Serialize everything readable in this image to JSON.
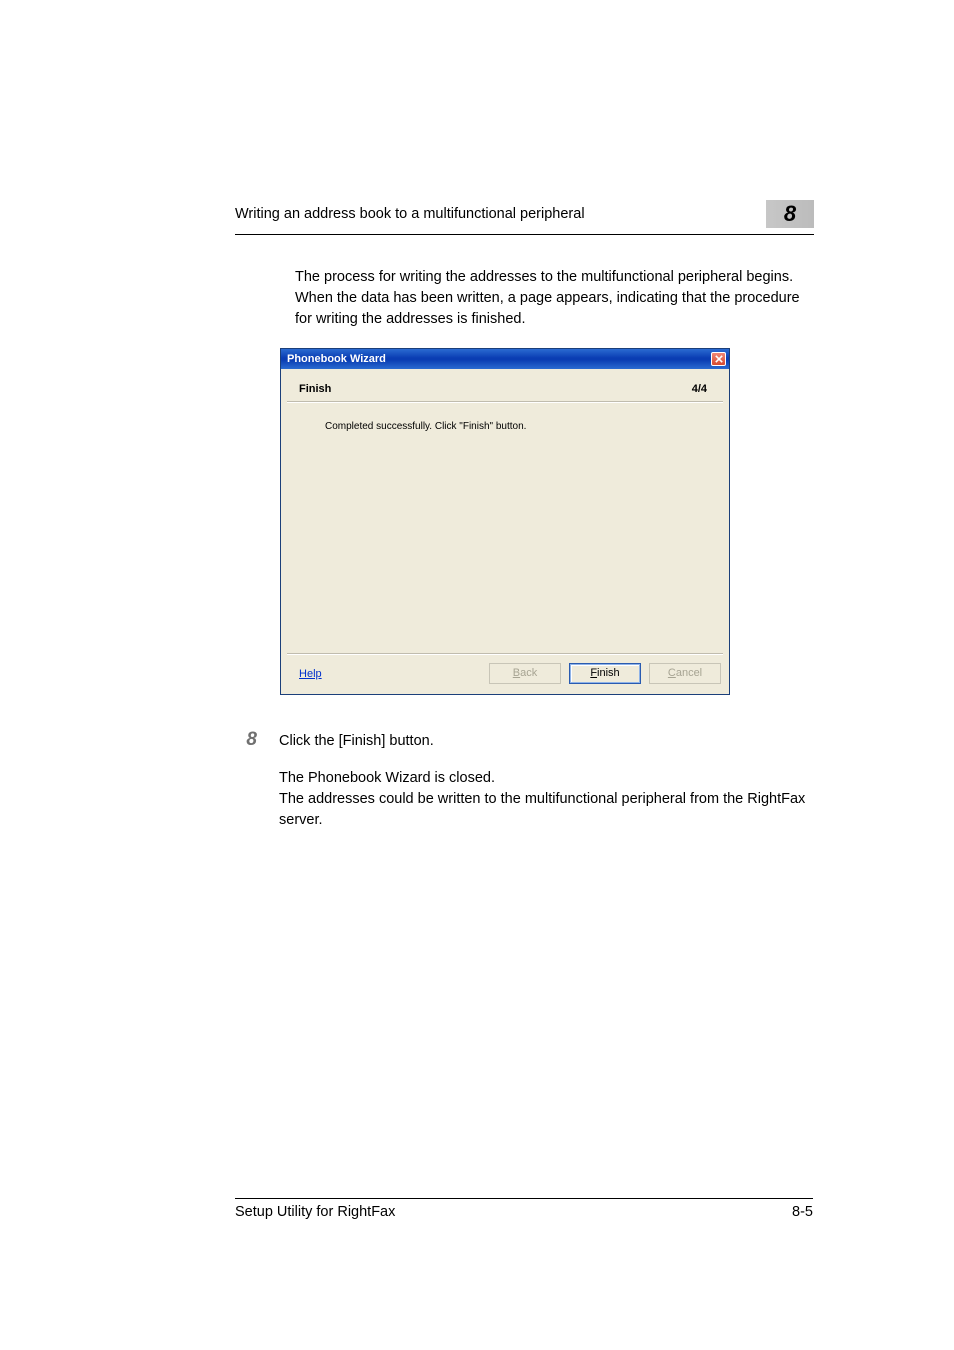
{
  "header": {
    "title": "Writing an address book to a multifunctional peripheral",
    "chapter_number": "8"
  },
  "intro_paragraph": "The process for writing the addresses to the multifunctional peripheral begins. When the data has been written, a page appears, indicating that the procedure for writing the addresses is finished.",
  "dialog": {
    "title": "Phonebook Wizard",
    "page_title": "Finish",
    "step": "4/4",
    "message": "Completed successfully. Click \"Finish\" button.",
    "help_label": "Help",
    "help_accesskey": "H",
    "buttons": {
      "back": {
        "label": "Back",
        "accesskey": "B",
        "enabled": false
      },
      "finish": {
        "label": "Finish",
        "accesskey": "F",
        "enabled": true
      },
      "cancel": {
        "label": "Cancel",
        "accesskey": "C",
        "enabled": false
      }
    }
  },
  "step8": {
    "number": "8",
    "instruction": "Click the [Finish] button.",
    "followup": "The Phonebook Wizard is closed.\nThe addresses could be written to the multifunctional peripheral from the RightFax server."
  },
  "footer": {
    "product": "Setup Utility for RightFax",
    "page": "8-5"
  }
}
